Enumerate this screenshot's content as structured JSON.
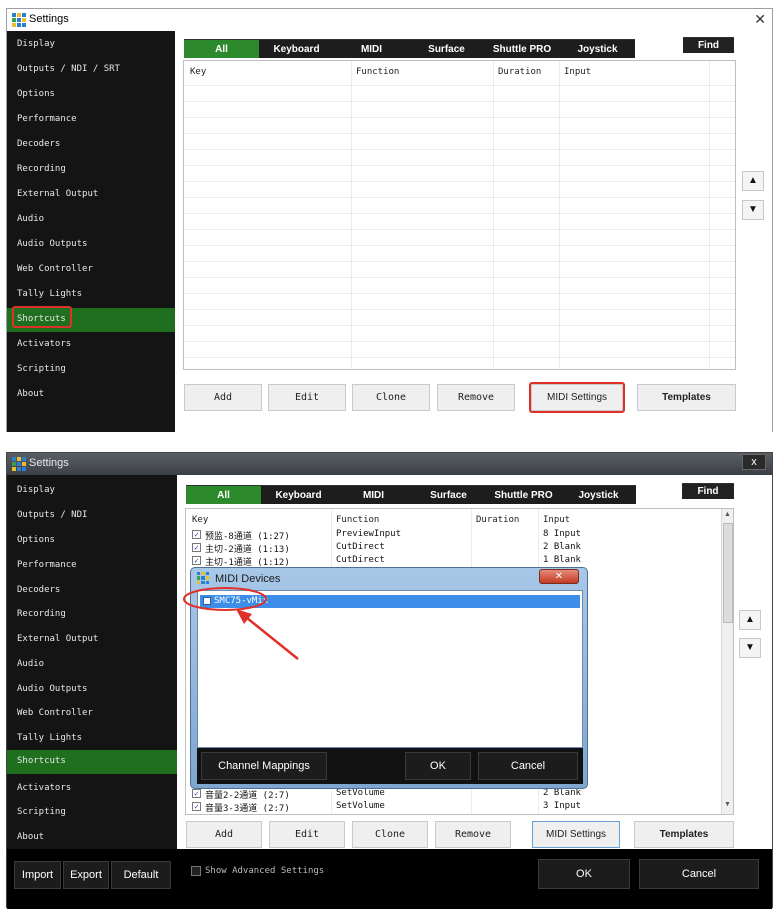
{
  "window1": {
    "title": "Settings",
    "close_glyph": "✕",
    "sidebar": [
      "Display",
      "Outputs / NDI / SRT",
      "Options",
      "Performance",
      "Decoders",
      "Recording",
      "External Output",
      "Audio",
      "Audio Outputs",
      "Web Controller",
      "Tally Lights",
      "Shortcuts",
      "Activators",
      "Scripting",
      "About"
    ],
    "active_item": "Shortcuts",
    "tabs": [
      "All",
      "Keyboard",
      "MIDI",
      "Surface",
      "Shuttle PRO",
      "Joystick"
    ],
    "find_label": "Find",
    "columns": [
      "Key",
      "Function",
      "Duration",
      "Input"
    ],
    "up_label": "▲",
    "down_label": "▼",
    "buttons": [
      "Add",
      "Edit",
      "Clone",
      "Remove",
      "MIDI Settings",
      "Templates"
    ]
  },
  "window2": {
    "title": "Settings",
    "close_glyph": "x",
    "sidebar": [
      "Display",
      "Outputs / NDI",
      "Options",
      "Performance",
      "Decoders",
      "Recording",
      "External Output",
      "Audio",
      "Audio Outputs",
      "Web Controller",
      "Tally Lights",
      "Shortcuts",
      "Activators",
      "Scripting",
      "About"
    ],
    "active_item": "Shortcuts",
    "tabs": [
      "All",
      "Keyboard",
      "MIDI",
      "Surface",
      "Shuttle PRO",
      "Joystick"
    ],
    "find_label": "Find",
    "columns": [
      "Key",
      "Function",
      "Duration",
      "Input"
    ],
    "rows_top": [
      {
        "key": "预监-8通道 (1:27)",
        "function": "PreviewInput",
        "input": "8 Input"
      },
      {
        "key": "主切-2通道 (1:13)",
        "function": "CutDirect",
        "input": "2 Blank"
      },
      {
        "key": "主切-1通道 (1:12)",
        "function": "CutDirect",
        "input": "1 Blank"
      }
    ],
    "rows_bottom": [
      {
        "key": "音量2-2通道 (2:7)",
        "function": "SetVolume",
        "input": "2 Blank"
      },
      {
        "key": "音量3-3通道 (2:7)",
        "function": "SetVolume",
        "input": "3 Input"
      }
    ],
    "buttons": [
      "Add",
      "Edit",
      "Clone",
      "Remove",
      "MIDI Settings",
      "Templates"
    ],
    "up_label": "▲",
    "down_label": "▼",
    "bottom_buttons": [
      "Import",
      "Export",
      "Default"
    ],
    "show_advanced": "Show Advanced Settings",
    "ok_label": "OK",
    "cancel_label": "Cancel"
  },
  "midi_dialog": {
    "title": "MIDI Devices",
    "close_glyph": "✕",
    "device": "SMC75-vMix",
    "buttons": [
      "Channel Mappings",
      "OK",
      "Cancel"
    ]
  },
  "colors": {
    "accent_green": "#2c8a2c",
    "highlight_red": "#e0302a",
    "sidebar_bg": "#141414"
  }
}
